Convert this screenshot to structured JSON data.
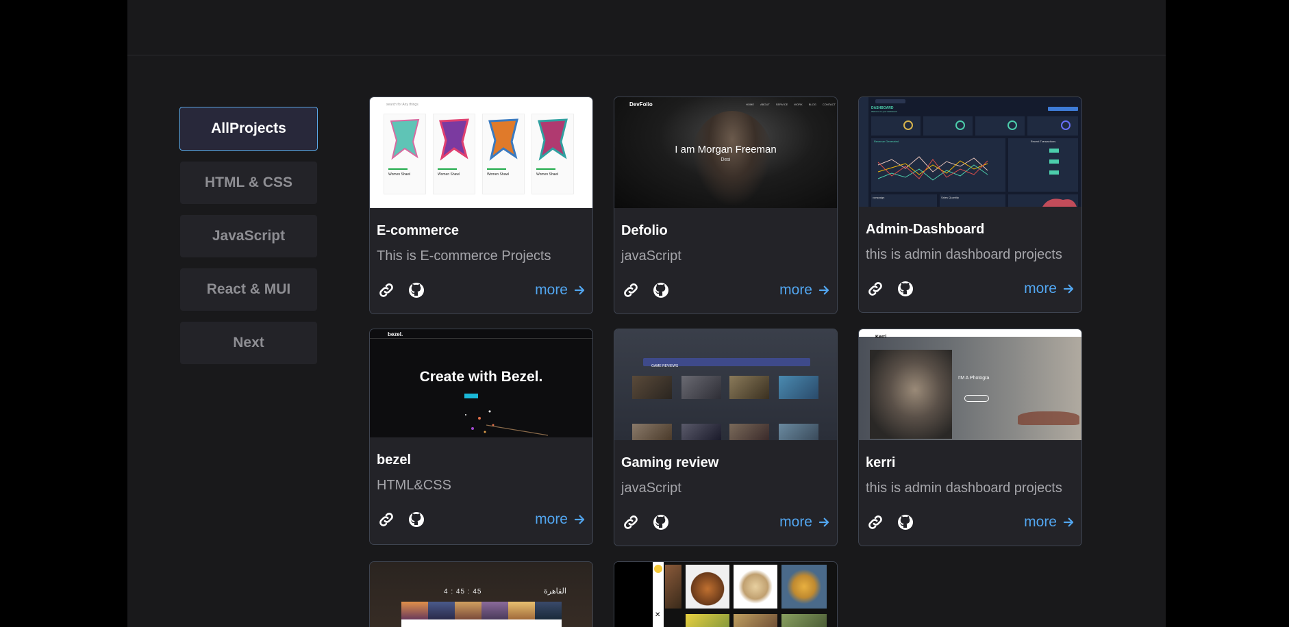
{
  "filters": [
    {
      "label": "AllProjects",
      "active": true
    },
    {
      "label": "HTML & CSS",
      "active": false
    },
    {
      "label": "JavaScript",
      "active": false
    },
    {
      "label": "React & MUI",
      "active": false
    },
    {
      "label": "Next",
      "active": false
    }
  ],
  "projects": [
    {
      "title": "E-commerce",
      "desc": "This is E-commerce Projects",
      "more": "more"
    },
    {
      "title": "Defolio",
      "desc": "javaScript",
      "more": "more"
    },
    {
      "title": "Admin-Dashboard",
      "desc": "this is admin dashboard projects",
      "more": "more"
    },
    {
      "title": "bezel",
      "desc": "HTML&CSS",
      "more": "more"
    },
    {
      "title": "Gaming review",
      "desc": "javaScript",
      "more": "more"
    },
    {
      "title": "kerri",
      "desc": "this is admin dashboard projects",
      "more": "more"
    }
  ],
  "thumbs": {
    "ecommerce": {
      "search": "search for Any things",
      "item_name": "Women Shawl"
    },
    "defolio": {
      "logo": "DevFolio",
      "headline": "I am Morgan Freeman",
      "sub": "Desi",
      "nav": [
        "HOME",
        "ABOUT",
        "SERVICE",
        "WORK",
        "BLOG",
        "CONTACT"
      ]
    },
    "dashboard": {
      "title": "DASHBOARD",
      "subtitle": "Welcome to your dashboard",
      "chart_title": "Revenue Generated",
      "side_title": "Recent Transactions",
      "bottom1": "campaign",
      "bottom2": "Sales Quantity"
    },
    "bezel": {
      "logo": "bezel.",
      "headline": "Create with Bezel."
    },
    "gaming": {
      "logo": "GAME REVIEWS"
    },
    "kerri": {
      "logo": "Kerri",
      "headline": "I'M A Photogra"
    },
    "arabic": {
      "clock": "4 : 45 : 45",
      "city": "القاهرة"
    }
  },
  "colors": {
    "accent": "#52a6f0",
    "card_bg": "#232328",
    "page_bg": "#19191b"
  }
}
